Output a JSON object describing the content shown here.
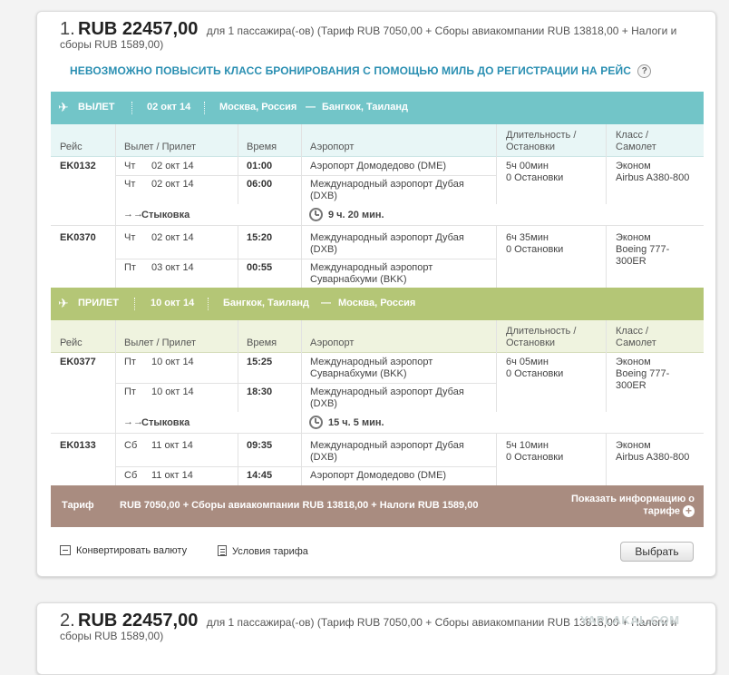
{
  "offer1": {
    "num": "1.",
    "amount": "RUB 22457,00",
    "desc": "для 1 пассажира(-ов) (Тариф RUB 7050,00 + Сборы авиакомпании RUB 13818,00 + Налоги и сборы RUB 1589,00)",
    "upgrade": "НЕВОЗМОЖНО ПОВЫСИТЬ КЛАСС БРОНИРОВАНИЯ С ПОМОЩЬЮ МИЛЬ ДО РЕГИСТРАЦИИ НА РЕЙС",
    "help": "?"
  },
  "columns": {
    "flight": "Рейс",
    "deparr": "Вылет / Прилет",
    "time": "Время",
    "airport": "Аэропорт",
    "duration": "Длительность /",
    "stops": "Остановки",
    "class": "Класс /",
    "aircraft": "Самолет"
  },
  "departure": {
    "label": "ВЫЛЕТ",
    "date": "02 окт 14",
    "from": "Москва, Россия",
    "dash": "—",
    "to": "Бангкок, Таиланд",
    "flights": [
      {
        "no": "EK0132",
        "rows": [
          {
            "day": "Чт",
            "date": "02 окт 14",
            "time": "01:00",
            "airport": "Аэропорт Домодедово (DME)",
            "airport2": ""
          },
          {
            "day": "Чт",
            "date": "02 окт 14",
            "time": "06:00",
            "airport": "Международный аэропорт Дубая",
            "airport2": "(DXB)"
          }
        ],
        "dur": "5ч 00мин",
        "stops": "0 Остановки",
        "cls": "Эконом",
        "plane": "Airbus A380-800",
        "plane2": ""
      },
      {
        "no": "EK0370",
        "rows": [
          {
            "day": "Чт",
            "date": "02 окт 14",
            "time": "15:20",
            "airport": "Международный аэропорт Дубая",
            "airport2": "(DXB)"
          },
          {
            "day": "Пт",
            "date": "03 окт 14",
            "time": "00:55",
            "airport": "Международный аэропорт",
            "airport2": "Суварнабхуми (BKK)"
          }
        ],
        "dur": "6ч 35мин",
        "stops": "0 Остановки",
        "cls": "Эконом",
        "plane": "Boeing 777-",
        "plane2": "300ER"
      }
    ],
    "connection": {
      "label": "Стыковка",
      "duration": "9 ч. 20 мин."
    }
  },
  "return": {
    "label": "ПРИЛЕТ",
    "date": "10 окт 14",
    "from": "Бангкок, Таиланд",
    "dash": "—",
    "to": "Москва, Россия",
    "flights": [
      {
        "no": "EK0377",
        "rows": [
          {
            "day": "Пт",
            "date": "10 окт 14",
            "time": "15:25",
            "airport": "Международный аэропорт",
            "airport2": "Суварнабхуми (BKK)"
          },
          {
            "day": "Пт",
            "date": "10 окт 14",
            "time": "18:30",
            "airport": "Международный аэропорт Дубая",
            "airport2": "(DXB)"
          }
        ],
        "dur": "6ч 05мин",
        "stops": "0 Остановки",
        "cls": "Эконом",
        "plane": "Boeing 777-",
        "plane2": "300ER"
      },
      {
        "no": "EK0133",
        "rows": [
          {
            "day": "Сб",
            "date": "11 окт 14",
            "time": "09:35",
            "airport": "Международный аэропорт Дубая",
            "airport2": "(DXB)"
          },
          {
            "day": "Сб",
            "date": "11 окт 14",
            "time": "14:45",
            "airport": "Аэропорт Домодедово (DME)",
            "airport2": ""
          }
        ],
        "dur": "5ч 10мин",
        "stops": "0 Остановки",
        "cls": "Эконом",
        "plane": "Airbus A380-800",
        "plane2": ""
      }
    ],
    "connection": {
      "label": "Стыковка",
      "duration": "15 ч. 5 мин."
    }
  },
  "tariff": {
    "label": "Тариф",
    "detail": "RUB 7050,00 + Сборы авиакомпании RUB 13818,00 + Налоги RUB 1589,00",
    "show1": "Показать информацию о",
    "show2": "тарифе",
    "plus": "+"
  },
  "footer": {
    "convert": "Конвертировать валюту",
    "conditions": "Условия тарифа",
    "select": "Выбрать"
  },
  "offer2": {
    "num": "2.",
    "amount": "RUB 22457,00",
    "desc": "для 1 пассажира(-ов) (Тариф RUB 7050,00 + Сборы авиакомпании RUB 13818,00 + Налоги и сборы RUB 1589,00)"
  },
  "watermark": "YAPLAKAL.COM",
  "colors": {
    "departure": "#72c5c8",
    "return": "#b4c676",
    "tariff": "#a98c80",
    "link": "#2a8fb2"
  }
}
